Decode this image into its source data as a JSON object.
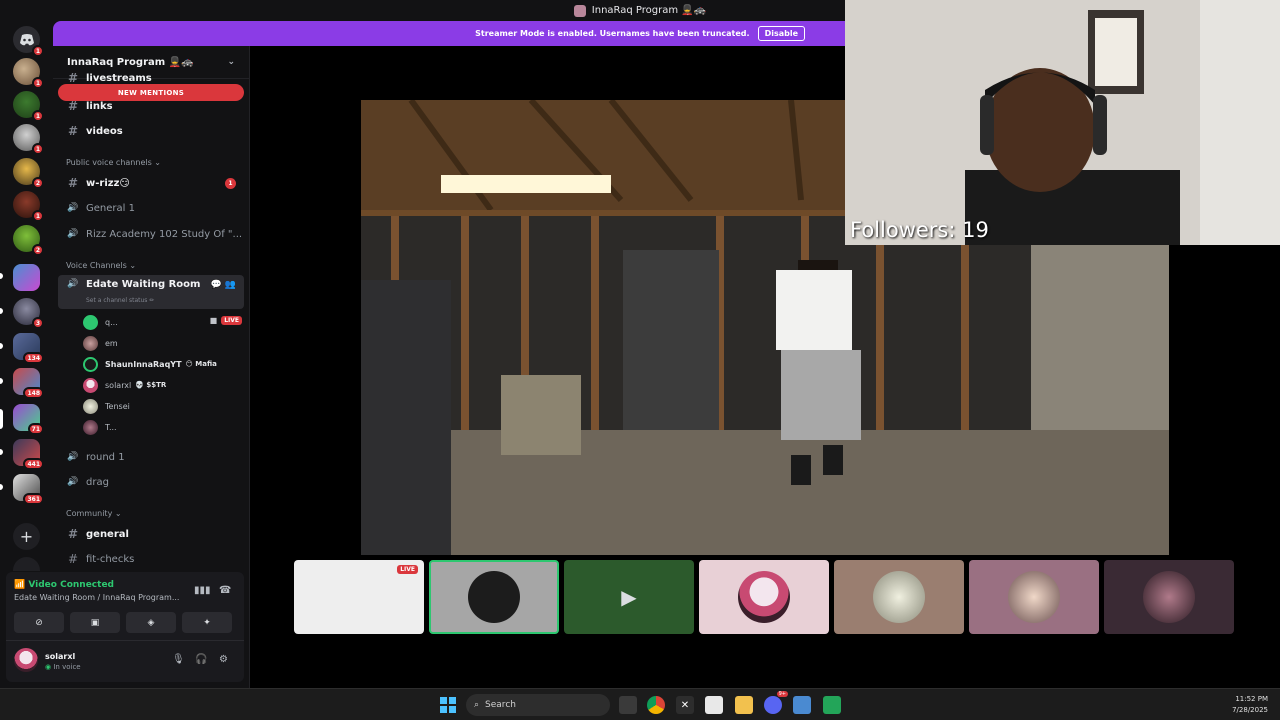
{
  "window": {
    "title": "InnaRaq Program 💂🚓"
  },
  "streamer_banner": {
    "text": "Streamer Mode is enabled. Usernames have been truncated.",
    "disable_label": "Disable"
  },
  "rail": {
    "badges": [
      "1",
      "1",
      "1",
      "1",
      "2",
      "1",
      "2",
      "3",
      "134",
      "148",
      "71",
      "441",
      "361"
    ]
  },
  "server": {
    "name": "InnaRaq Program 💂🚓",
    "chevron": "⌄"
  },
  "new_mentions": "NEW MENTIONS",
  "channels": {
    "livestreams": "livestreams",
    "links": "links",
    "videos": "videos",
    "cat_public_voice": "Public voice channels ⌄",
    "w_rizz": "w-rizz😏",
    "w_rizz_badge": "1",
    "general1": "General 1",
    "rizz_academy": "Rizz Academy 102 Study Of \"...",
    "cat_voice": "Voice Channels ⌄",
    "edate": "Edate Waiting Room",
    "edate_status": "Set a channel status ✏",
    "round1": "round 1",
    "drag": "drag",
    "cat_community": "Community ⌄",
    "general": "general",
    "fit_checks": "fit-checks"
  },
  "voice_users": [
    {
      "name": "q...",
      "live": "LIVE"
    },
    {
      "name": "em"
    },
    {
      "name": "ShaunInnaRaqYT",
      "tag": "😶 Mafia"
    },
    {
      "name": "solarxl",
      "tag": "💀 $$TR"
    },
    {
      "name": "Tensei"
    },
    {
      "name": "T..."
    }
  ],
  "voice_panel": {
    "title": "Video Connected",
    "subtitle": "Edate Waiting Room / InnaRaq Program..."
  },
  "user": {
    "name": "solarxl",
    "status": "In voice"
  },
  "stage_tiles": {
    "live_label": "LIVE"
  },
  "overlay": {
    "followers": "Followers: 19"
  },
  "taskbar": {
    "search_placeholder": "Search",
    "time": "11:52 PM",
    "date": "7/28/2025",
    "discord_badge": "9+"
  },
  "colors": {
    "accent": "#8b3ce6",
    "danger": "#da373c",
    "connected": "#2dc770"
  }
}
